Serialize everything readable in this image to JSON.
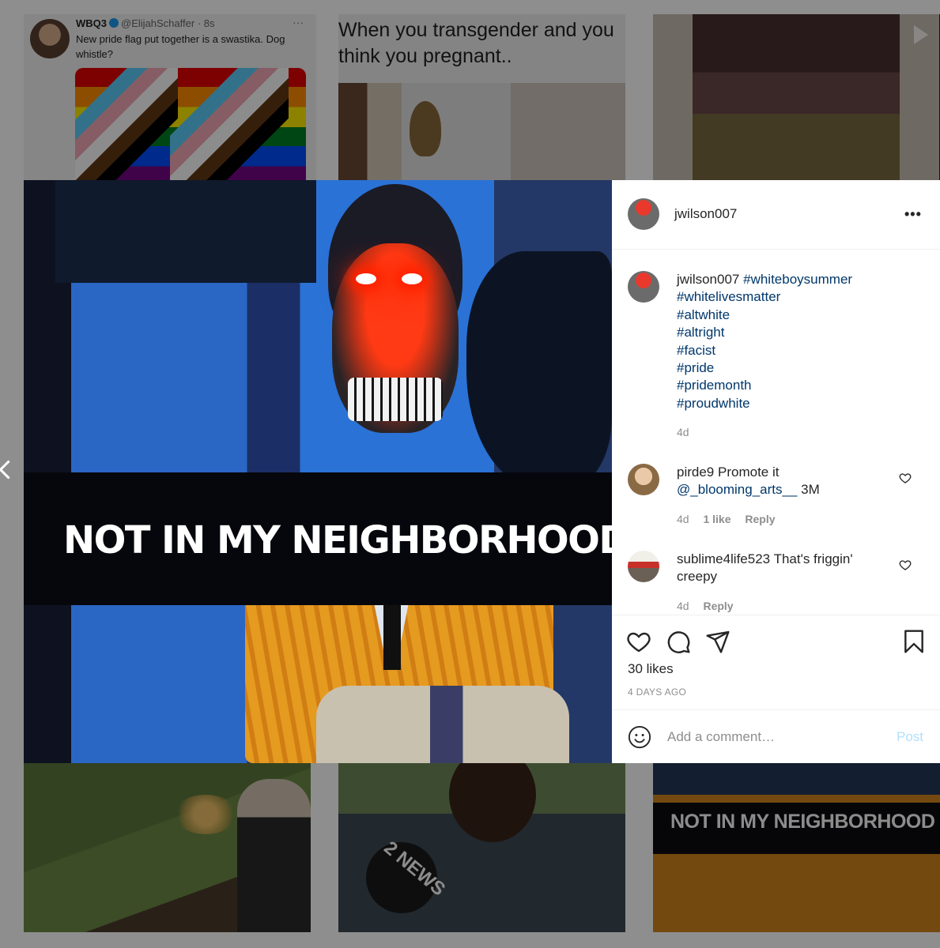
{
  "background_tiles": {
    "tweet": {
      "name": "WBQ3",
      "handle": "@ElijahSchaffer · 8s",
      "more": "···",
      "text": "New pride flag put together is a swastika. Dog whistle?"
    },
    "meme": {
      "text": "When you transgender and you\nthink you pregnant.."
    },
    "news": {
      "logo": "2 NEWS"
    },
    "neighborhood_caption": "NOT IN MY NEIGHBORHOOD"
  },
  "post": {
    "image_caption": "NOT IN MY NEIGHBORHOOD",
    "header": {
      "username": "jwilson007",
      "more": "•••"
    },
    "caption": {
      "username": "jwilson007",
      "hashtags": [
        "#whiteboysummer",
        "#whitelivesmatter",
        "#altwhite",
        "#altright",
        "#facist",
        "#pride",
        "#pridemonth",
        "#proudwhite"
      ],
      "time": "4d"
    },
    "comments": [
      {
        "username": "pirde9",
        "text": "Promote it",
        "mention": "@_blooming_arts__",
        "after_mention": " 3M",
        "time": "4d",
        "likes": "1 like",
        "reply": "Reply"
      },
      {
        "username": "sublime4life523",
        "text": "That's friggin' creepy",
        "time": "4d",
        "reply": "Reply"
      }
    ],
    "likes": "30 likes",
    "timestamp": "4 DAYS AGO",
    "add_comment": {
      "placeholder": "Add a comment…",
      "post_label": "Post"
    }
  }
}
